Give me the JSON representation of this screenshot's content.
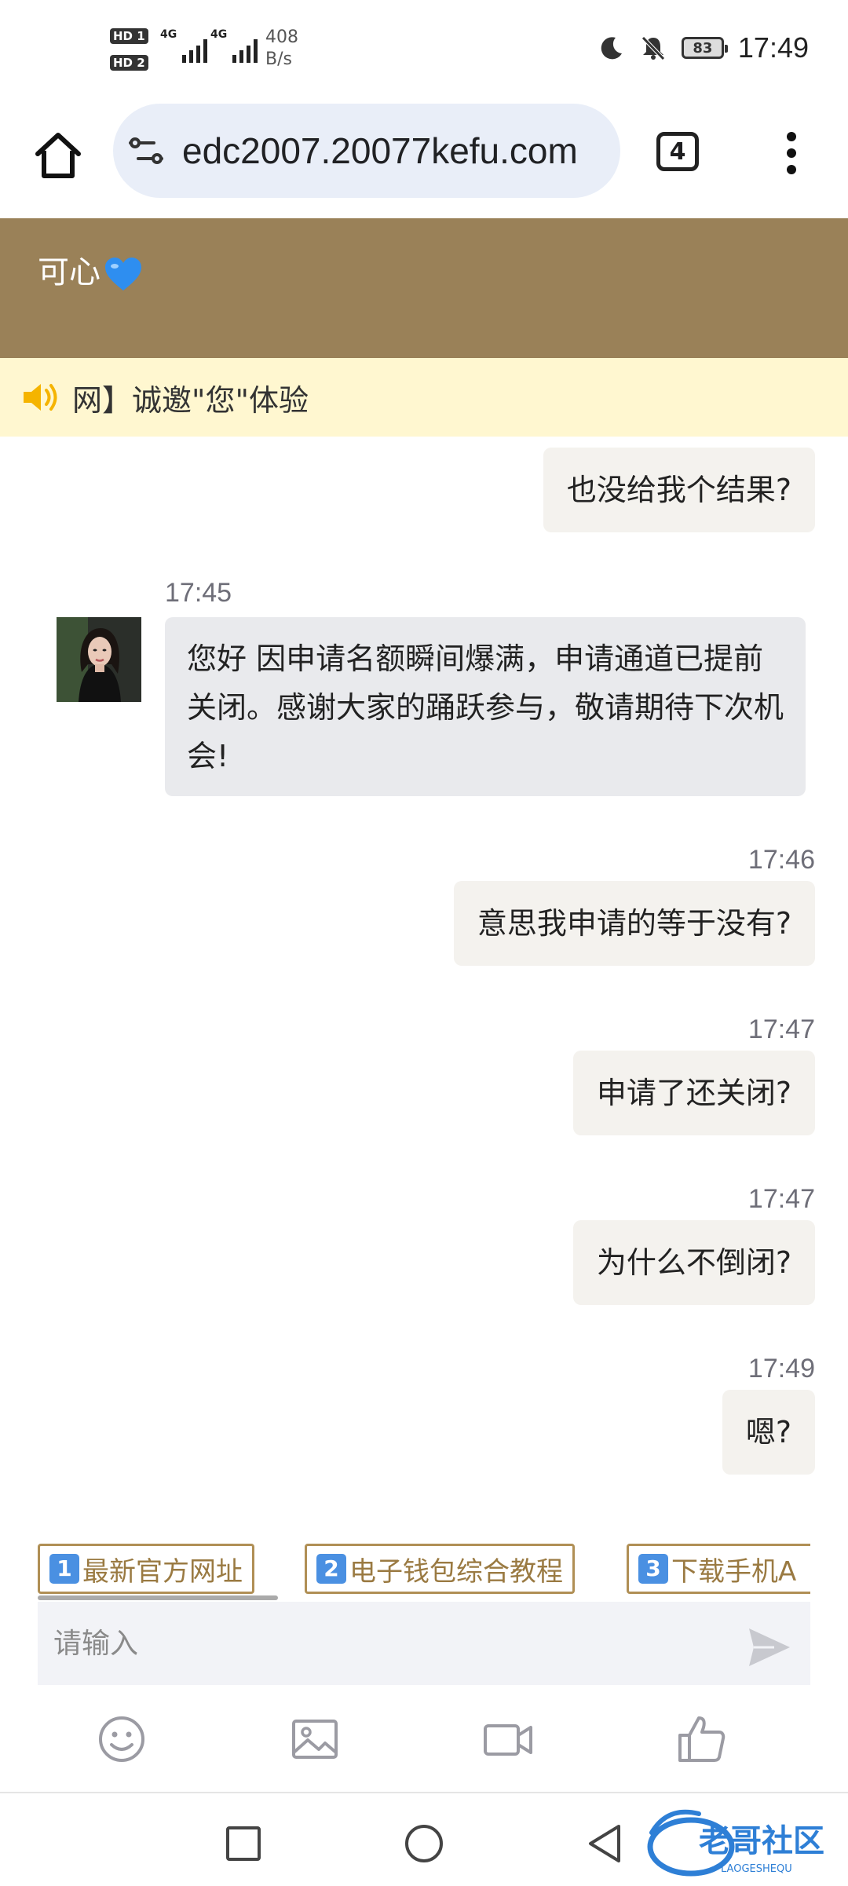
{
  "status_bar": {
    "sim1": "HD 1",
    "sim2": "HD 2",
    "network1": "4G",
    "network2": "4G",
    "speed_value": "408",
    "speed_unit": "B/s",
    "battery": "83",
    "time": "17:49"
  },
  "browser": {
    "url": "edc2007.20077kefu.com",
    "tab_count": "4"
  },
  "chat": {
    "agent_name": "可心",
    "notice": "网】诚邀\"您\"体验",
    "messages": [
      {
        "sender": "user",
        "text": "也没给我个结果?"
      },
      {
        "sender": "agent",
        "time": "17:45",
        "text": "您好 因申请名额瞬间爆满，申请通道已提前关闭。感谢大家的踊跃参与，敬请期待下次机会!"
      },
      {
        "sender": "user",
        "time": "17:46",
        "text": "意思我申请的等于没有?"
      },
      {
        "sender": "user",
        "time": "17:47",
        "text": "申请了还关闭?"
      },
      {
        "sender": "user",
        "time": "17:47",
        "text": "为什么不倒闭?"
      },
      {
        "sender": "user",
        "time": "17:49",
        "text": "嗯?"
      }
    ]
  },
  "quick_replies": [
    {
      "num": "1",
      "label": "最新官方网址"
    },
    {
      "num": "2",
      "label": "电子钱包综合教程"
    },
    {
      "num": "3",
      "label": "下载手机A"
    }
  ],
  "input": {
    "placeholder": "请输入"
  },
  "watermark": {
    "text": "老哥社区",
    "subtext": "LAOGESHEQU"
  },
  "colors": {
    "header_bg": "#9a8158",
    "notice_bg": "#fff7d0",
    "chip_border": "#b08f55",
    "url_bg": "#e9eef8"
  }
}
